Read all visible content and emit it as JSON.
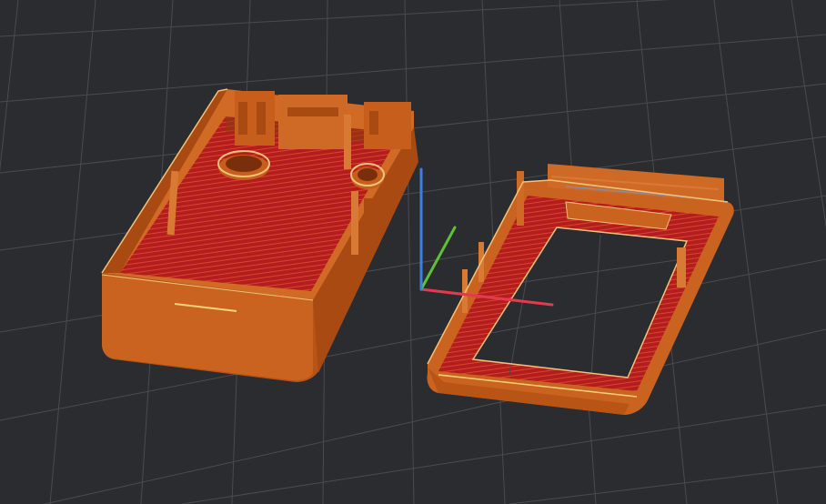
{
  "viewport": {
    "background": "#2b2c30",
    "grid_color": "#4a4b51"
  },
  "objects": [
    {
      "name": "case-base",
      "color": "#c9611b",
      "infill": "#b41d1d"
    },
    {
      "name": "case-lid",
      "color": "#c9611b",
      "infill": "#b41d1d"
    }
  ],
  "axes": {
    "x_color": "#e33a4d",
    "y_color": "#5cc234",
    "z_color": "#3b80e0"
  }
}
